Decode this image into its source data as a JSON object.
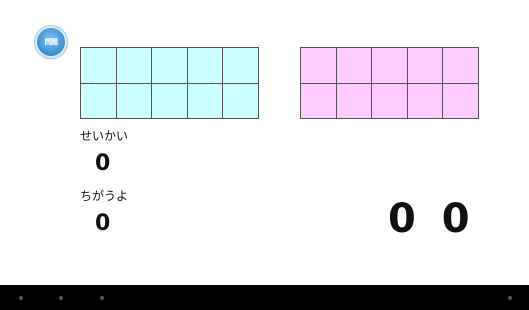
{
  "problem_button": {
    "label": "問題"
  },
  "answer_grid": {
    "rows": 2,
    "cols": 5,
    "color": "#ccffff"
  },
  "target_grid": {
    "rows": 2,
    "cols": 5,
    "color": "#ffccff"
  },
  "correct": {
    "label": "せいかい",
    "count": "0"
  },
  "wrong": {
    "label": "ちがうよ",
    "count": "0"
  },
  "score_display": "0 0",
  "nav_bar": {
    "dots": 4
  }
}
